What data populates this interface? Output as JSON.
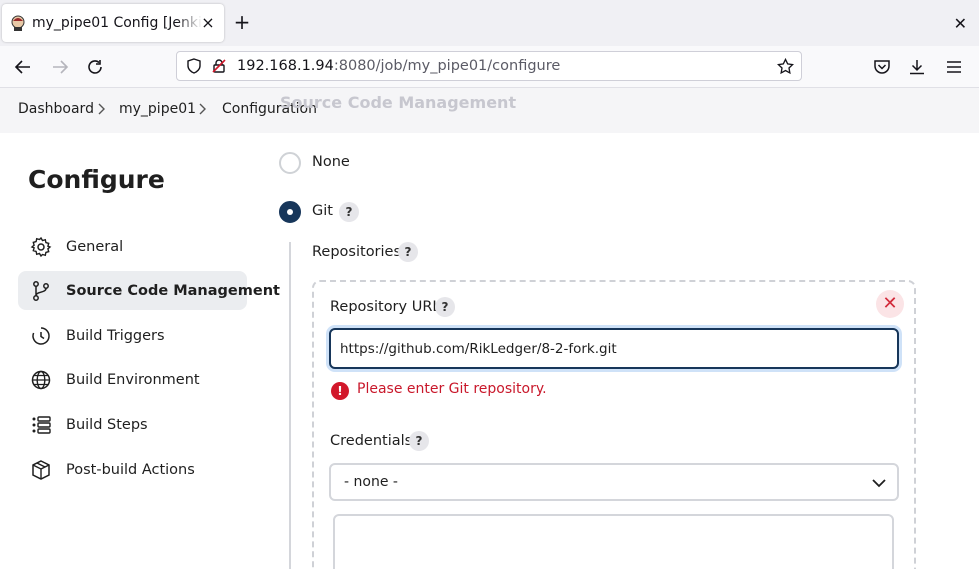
{
  "browser": {
    "tab_title": "my_pipe01 Config [Jenkins]",
    "tab_close": "×",
    "new_tab": "+",
    "window_close": "✕",
    "url_host": "192.168.1.94",
    "url_rest": ":8080/job/my_pipe01/configure"
  },
  "breadcrumb": {
    "items": [
      "Dashboard",
      "my_pipe01",
      "Configuration"
    ],
    "sticky_title": "Source Code Management"
  },
  "sidebar": {
    "title": "Configure",
    "items": [
      {
        "label": "General",
        "icon": "gear-icon",
        "active": false
      },
      {
        "label": "Source Code Management",
        "icon": "git-branch-icon",
        "active": true
      },
      {
        "label": "Build Triggers",
        "icon": "clock-icon",
        "active": false
      },
      {
        "label": "Build Environment",
        "icon": "globe-icon",
        "active": false
      },
      {
        "label": "Build Steps",
        "icon": "list-icon",
        "active": false
      },
      {
        "label": "Post-build Actions",
        "icon": "package-icon",
        "active": false
      }
    ]
  },
  "scm": {
    "option_none": "None",
    "option_git": "Git",
    "help_label": "?",
    "repositories_label": "Repositories",
    "repo_url_label": "Repository URL",
    "repo_url_value": "https://github.com/RikLedger/8-2-fork.git",
    "error_icon": "!",
    "error_text": "Please enter Git repository.",
    "delete_label": "✕",
    "credentials_label": "Credentials",
    "credentials_value": "- none -"
  },
  "colors": {
    "accent": "#17365a",
    "error": "#d2182b",
    "active_bg": "#ebedf0"
  }
}
